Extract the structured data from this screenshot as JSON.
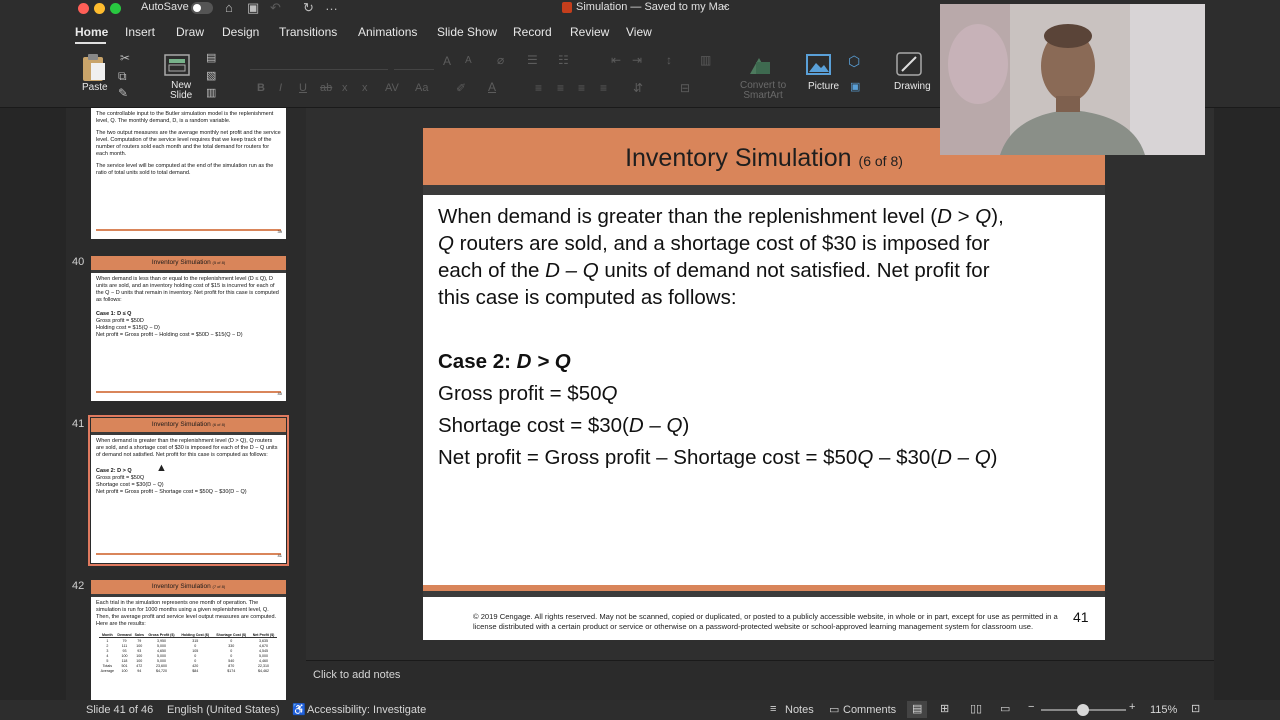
{
  "titlebar": {
    "autosave_label": "AutoSave",
    "document_title": "Simulation — Saved to my Mac",
    "title_chevron": "⌄"
  },
  "tabs": [
    "Home",
    "Insert",
    "Draw",
    "Design",
    "Transitions",
    "Animations",
    "Slide Show",
    "Record",
    "Review",
    "View"
  ],
  "ribbon": {
    "paste_label": "Paste",
    "new_slide_label": "New\nSlide",
    "convert_label": "Convert to\nSmartArt",
    "picture_label": "Picture",
    "drawing_label": "Drawing"
  },
  "thumbnails": {
    "t39": {
      "lines": [
        "The controllable input to the Butler simulation model is the replenishment level, Q. The monthly demand, D, is a random variable.",
        "The two output measures are the average monthly net profit and the service level. Computation of the service level requires that we keep track of the number of routers sold each month and the total demand for routers for each month.",
        "The service level will be computed at the end of the simulation run as the ratio of total units sold to total demand."
      ],
      "page": "39"
    },
    "t40": {
      "number": "40",
      "title": "Inventory Simulation",
      "title_small": "(5 of 8)",
      "intro": "When demand is less than or equal to the replenishment level (D ≤ Q), D units are sold, and an inventory holding cost of $15 is incurred for each of the Q − D units that remain in inventory. Net profit for this case is computed as follows:",
      "case": "Case 1: D ≤ Q",
      "l1": "Gross profit = $50D",
      "l2": "Holding cost = $15(Q − D)",
      "l3": "Net profit = Gross profit − Holding cost = $50D − $15(Q − D)",
      "page": "40"
    },
    "t41": {
      "number": "41",
      "title": "Inventory Simulation",
      "title_small": "(6 of 8)",
      "intro": "When demand is greater than the replenishment level (D > Q), Q routers are sold, and a shortage cost of $30 is imposed for each of the D − Q units of demand not satisfied. Net profit for this case is computed as follows:",
      "case": "Case 2: D > Q",
      "l1": "Gross profit = $50Q",
      "l2": "Shortage cost = $30(D − Q)",
      "l3": "Net profit = Gross profit − Shortage cost = $50Q − $30(D − Q)",
      "page": "41"
    },
    "t42": {
      "number": "42",
      "title": "Inventory Simulation",
      "title_small": "(7 of 8)",
      "intro": "Each trial in the simulation represents one month of operation. The simulation is run for 1000 months using a given replenishment level, Q. Then, the average profit and service level output measures are computed. Here are the results:",
      "table_headers": [
        "Month",
        "Demand",
        "Sales",
        "Gross Profit ($)",
        "Holding Cost ($)",
        "Shortage Cost ($)",
        "Net Profit ($)"
      ],
      "table_rows": [
        [
          "1",
          "79",
          "79",
          "3,950",
          "315",
          "0",
          "3,635"
        ],
        [
          "2",
          "111",
          "100",
          "5,000",
          "0",
          "330",
          "4,670"
        ],
        [
          "3",
          "93",
          "93",
          "4,650",
          "105",
          "0",
          "4,545"
        ],
        [
          "4",
          "100",
          "100",
          "5,000",
          "0",
          "0",
          "5,000"
        ],
        [
          "5",
          "118",
          "100",
          "5,000",
          "0",
          "540",
          "4,460"
        ],
        [
          "Totals",
          "501",
          "472",
          "23,600",
          "420",
          "870",
          "22,310"
        ],
        [
          "Average",
          "100",
          "94",
          "$4,720",
          "$84",
          "$174",
          "$4,462"
        ]
      ]
    }
  },
  "slide": {
    "title": "Inventory Simulation",
    "title_small": "(6 of 8)",
    "p1_a": "When demand is greater than the replenishment level (",
    "p1_d": "D",
    "p1_b": " > ",
    "p1_q": "Q",
    "p1_c": "),",
    "p2_q": "Q",
    "p2_a": " routers are sold, and a shortage cost of $30 is imposed for",
    "p3_a": "each of the ",
    "p3_dq": "D – Q",
    "p3_b": " units of demand not satisfied. Net profit for",
    "p4": "this case is computed as follows:",
    "case_label": "Case 2: ",
    "case_expr": "D > Q",
    "gross_a": "Gross profit = $50",
    "gross_q": "Q",
    "short_a": "Shortage cost = $30(",
    "short_dq": "D – Q",
    "short_b": ")",
    "net_a": "Net profit = Gross profit – Shortage cost = $50",
    "net_q": "Q",
    "net_b": " – $30(",
    "net_dq": "D – Q",
    "net_c": ")",
    "copyright": "© 2019 Cengage. All rights reserved. May not be scanned, copied or duplicated, or posted to a publicly accessible website, in whole or in part, except for use as permitted in a license distributed with a certain product or service or otherwise on a password-protected website or school-approved learning management system for classroom use.",
    "page_number": "41"
  },
  "notes_placeholder": "Click to add notes",
  "status": {
    "slide_indicator": "Slide 41 of 46",
    "language": "English (United States)",
    "accessibility": "Accessibility: Investigate",
    "notes": "Notes",
    "comments": "Comments",
    "zoom": "115%"
  },
  "colors": {
    "accent_orange": "#d9855a",
    "dark_band": "#3b3b3b",
    "selection": "#e07a5f",
    "active_tab_underline": "#e0e0e0"
  }
}
